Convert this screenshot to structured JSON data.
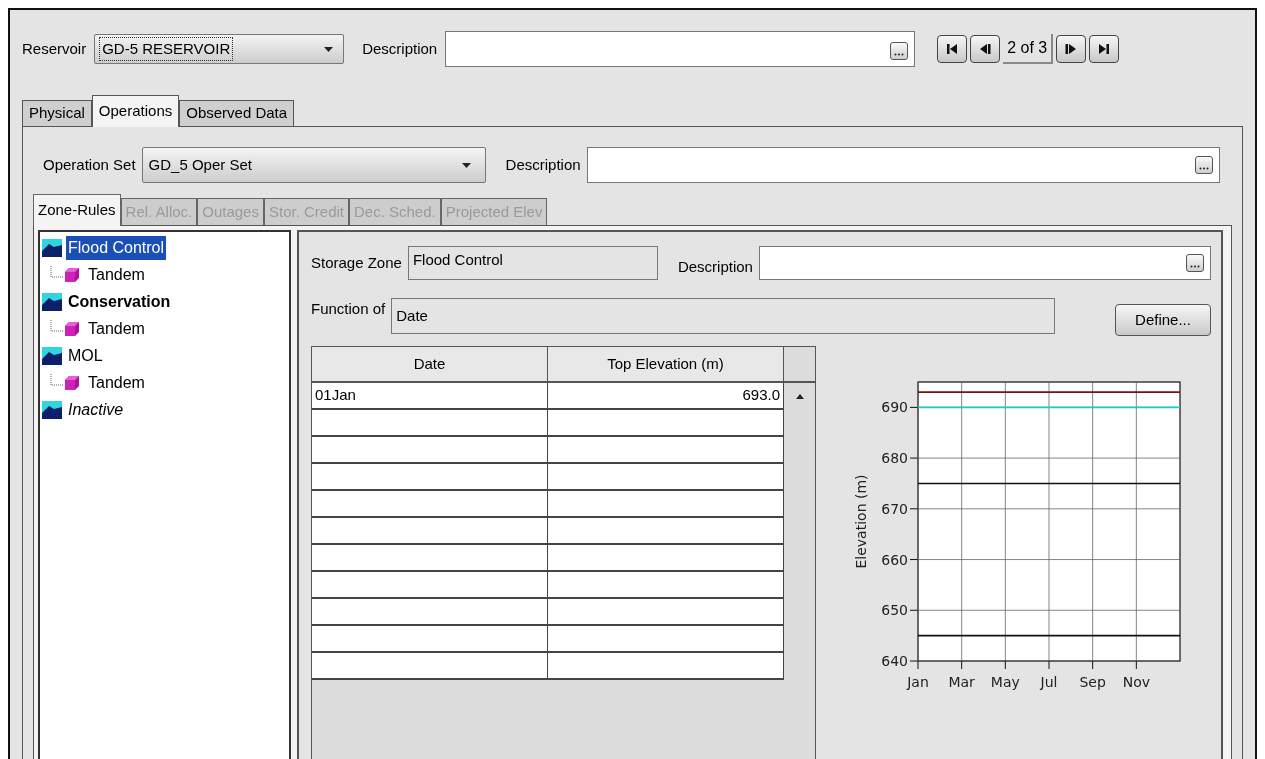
{
  "reservoir": {
    "label": "Reservoir",
    "value": "GD-5 RESERVOIR",
    "description_label": "Description",
    "navigator": {
      "position": "2 of 3"
    }
  },
  "tabs": [
    {
      "label": "Physical",
      "selected": false
    },
    {
      "label": "Operations",
      "selected": true
    },
    {
      "label": "Observed Data",
      "selected": false
    }
  ],
  "operation_set": {
    "label": "Operation Set",
    "value": "GD_5 Oper Set",
    "description_label": "Description"
  },
  "sub_tabs": [
    {
      "label": "Zone-Rules",
      "selected": true,
      "disabled": false
    },
    {
      "label": "Rel. Alloc.",
      "selected": false,
      "disabled": true
    },
    {
      "label": "Outages",
      "selected": false,
      "disabled": true
    },
    {
      "label": "Stor. Credit",
      "selected": false,
      "disabled": true
    },
    {
      "label": "Dec. Sched.",
      "selected": false,
      "disabled": true
    },
    {
      "label": "Projected Elev",
      "selected": false,
      "disabled": true
    }
  ],
  "tree": [
    {
      "label": "Flood Control",
      "kind": "zone",
      "selected": true,
      "children": [
        {
          "label": "Tandem",
          "selected": false
        }
      ]
    },
    {
      "label": "Conservation",
      "kind": "primary",
      "selected": false,
      "children": [
        {
          "label": "Tandem",
          "selected": false
        }
      ]
    },
    {
      "label": "MOL",
      "kind": "zone",
      "selected": false,
      "children": [
        {
          "label": "Tandem",
          "selected": false
        }
      ]
    },
    {
      "label": "Inactive",
      "kind": "inactive",
      "selected": false
    }
  ],
  "zone": {
    "storage_zone_label": "Storage Zone",
    "storage_zone": "Flood Control",
    "description_label": "Description",
    "function_label": "Function of",
    "function": "Date",
    "define_button": "Define..."
  },
  "table": {
    "columns": [
      "Date",
      "Top Elevation (m)"
    ],
    "rows": [
      [
        "01Jan",
        "693.0"
      ]
    ]
  },
  "chart_data": {
    "type": "line",
    "ylabel": "Elevation (m)",
    "categories": [
      "Jan",
      null,
      "Mar",
      null,
      "May",
      null,
      "Jul",
      null,
      "Sep",
      null,
      "Nov",
      null,
      null
    ],
    "grid": true,
    "ylim": [
      640,
      695
    ],
    "yticks": [
      640,
      650,
      660,
      670,
      680,
      690
    ],
    "series": [
      {
        "color": "#7a1010",
        "values": [
          693,
          693,
          693,
          693,
          693,
          693,
          693,
          693,
          693,
          693,
          693,
          693,
          693
        ]
      },
      {
        "color": "#20c8c8",
        "values": [
          690,
          690,
          690,
          690,
          690,
          690,
          690,
          690,
          690,
          690,
          690,
          690,
          690
        ]
      },
      {
        "color": "#111111",
        "values": [
          675,
          675,
          675,
          675,
          675,
          675,
          675,
          675,
          675,
          675,
          675,
          675,
          675
        ]
      },
      {
        "color": "#111111",
        "values": [
          645,
          645,
          645,
          645,
          645,
          645,
          645,
          645,
          645,
          645,
          645,
          645,
          645
        ]
      }
    ]
  }
}
